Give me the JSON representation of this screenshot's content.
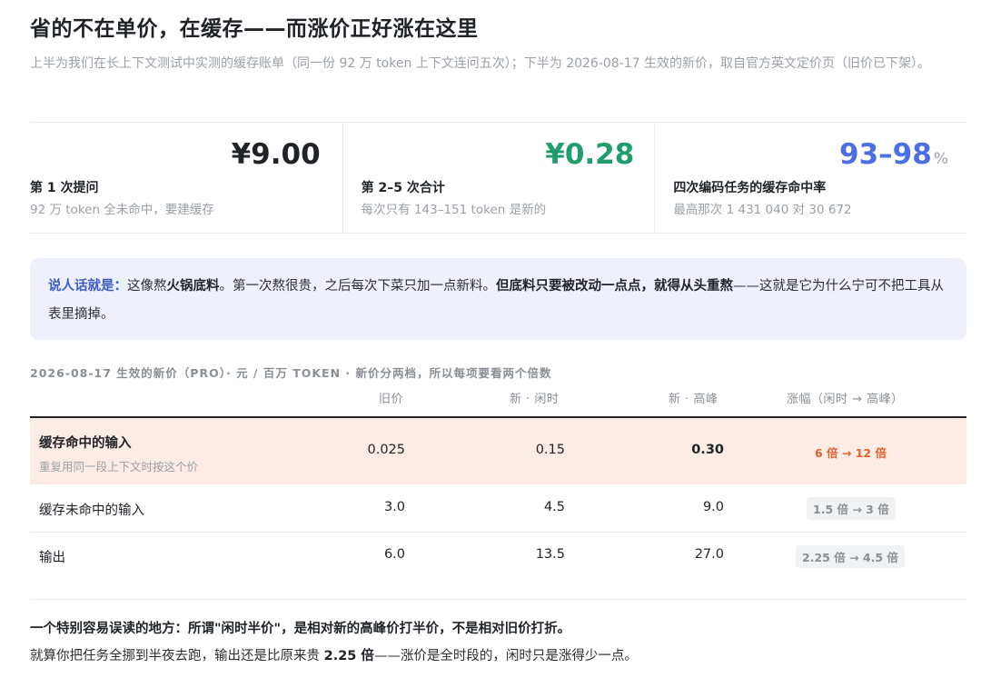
{
  "header": {
    "title": "省的不在单价，在缓存——而涨价正好涨在这里",
    "subtitle": "上半为我们在长上下文测试中实测的缓存账单（同一份 92 万 token 上下文连问五次）；下半为 2026-08-17 生效的新价，取自官方英文定价页（旧价已下架）。"
  },
  "stats": [
    {
      "value": "¥9.00",
      "unit": "",
      "color": "#1f2328",
      "label": "第 1 次提问",
      "sub": "92 万 token 全未命中，要建缓存"
    },
    {
      "value": "¥0.28",
      "unit": "",
      "color": "#1f9d6b",
      "label": "第 2–5 次合计",
      "sub": "每次只有 143–151 token 是新的"
    },
    {
      "value": "93–98",
      "unit": "%",
      "color": "#4a6fe3",
      "label": "四次编码任务的缓存命中率",
      "sub": "最高那次 1 431 040 对 30 672"
    }
  ],
  "callout": {
    "lead": "说人话就是：",
    "t1": "这像熬",
    "b1": "火锅底料",
    "t2": "。第一次熬很贵，之后每次下菜只加一点新料。",
    "b2": "但底料只要被改动一点点，就得从头重熬",
    "t3": "——这就是它为什么宁可不把工具从表里摘掉。"
  },
  "table": {
    "caption": "2026-08-17 生效的新价（PRO）· 元 / 百万 TOKEN · 新价分两档，所以每项要看两个倍数",
    "headers": {
      "old": "旧价",
      "offpeak": "新 · 闲时",
      "peak": "新 · 高峰",
      "change": "涨幅（闲时 → 高峰）"
    },
    "rows": [
      {
        "name": "缓存命中的输入",
        "desc": "重复用同一段上下文时按这个价",
        "old": "0.025",
        "offpeak": "0.15",
        "peak": "0.30",
        "change": "6 倍 → 12 倍"
      },
      {
        "name": "缓存未命中的输入",
        "desc": "",
        "old": "3.0",
        "offpeak": "4.5",
        "peak": "9.0",
        "change": "1.5 倍 → 3 倍"
      },
      {
        "name": "输出",
        "desc": "",
        "old": "6.0",
        "offpeak": "13.5",
        "peak": "27.0",
        "change": "2.25 倍 → 4.5 倍"
      }
    ]
  },
  "notes": {
    "line1": "一个特别容易误读的地方：所谓\"闲时半价\"，是相对新的高峰价打半价，不是相对旧价打折。",
    "line2a": "就算你把任务全挪到半夜去跑，输出还是比原来贵 ",
    "line2b": "2.25 倍",
    "line2c": "——涨价是全时段的，闲时只是涨得少一点。"
  }
}
